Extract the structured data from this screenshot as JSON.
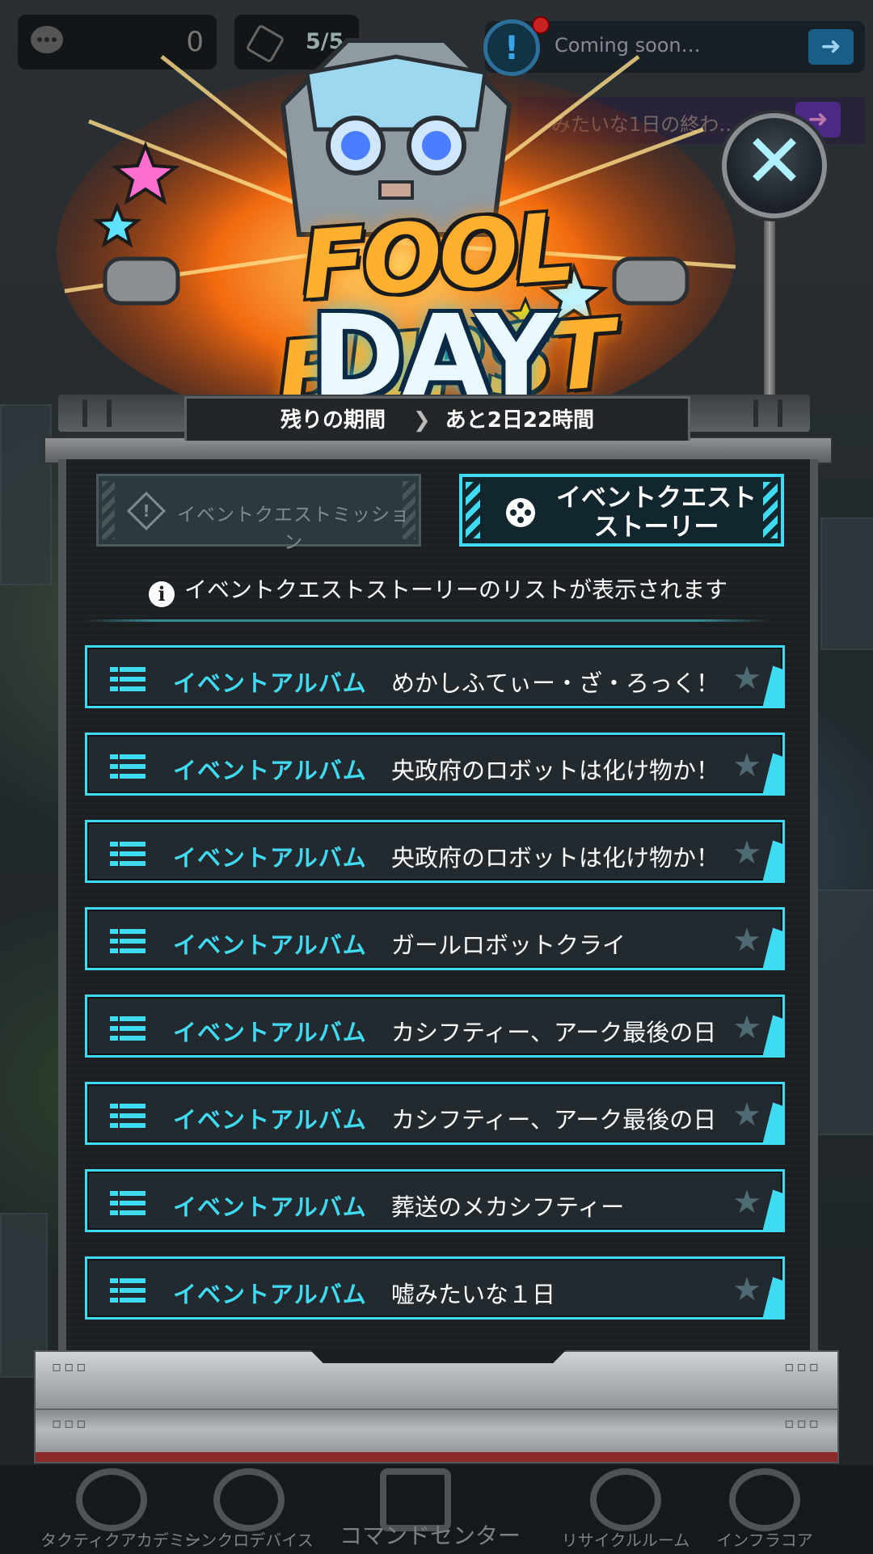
{
  "hud": {
    "chat_count": "0",
    "ticket_count": "5/5",
    "notice_text": "Coming soon…",
    "notice2_text": "みたいな1日の終わ…"
  },
  "banner": {
    "logo_line1": "FOOL BURST",
    "logo_line2": "DAY",
    "timer_label": "残りの期間",
    "timer_value": "あと2日22時間"
  },
  "tabs": {
    "mission_label": "イベントクエストミッション",
    "story_label": "イベントクエスト\nストーリー"
  },
  "info_text": "イベントクエストストーリーのリストが表示されます",
  "list": [
    {
      "category": "イベントアルバム",
      "title": "めかしふてぃー・ざ・ろっく！"
    },
    {
      "category": "イベントアルバム",
      "title": "央政府のロボットは化け物か！"
    },
    {
      "category": "イベントアルバム",
      "title": "央政府のロボットは化け物か！"
    },
    {
      "category": "イベントアルバム",
      "title": "ガールロボットクライ"
    },
    {
      "category": "イベントアルバム",
      "title": "カシフティー、アーク最後の日"
    },
    {
      "category": "イベントアルバム",
      "title": "カシフティー、アーク最後の日"
    },
    {
      "category": "イベントアルバム",
      "title": "葬送のメカシフティー"
    },
    {
      "category": "イベントアルバム",
      "title": "嘘みたいな１日"
    }
  ],
  "bottom_nav": [
    {
      "label": "タクティクアカデミー",
      "icon": "graduation-cap-icon"
    },
    {
      "label": "シンクロデバイス",
      "icon": "shield-sc-icon"
    },
    {
      "label": "コマンドセンター",
      "icon": "command-center-icon"
    },
    {
      "label": "リサイクルルーム",
      "icon": "recycle-icon"
    },
    {
      "label": "インフラコア",
      "icon": "infra-core-icon"
    }
  ],
  "colors": {
    "accent_cyan": "#3fdbf2",
    "panel_bg": "#1b1f22",
    "logo_orange": "#ffb02e"
  }
}
